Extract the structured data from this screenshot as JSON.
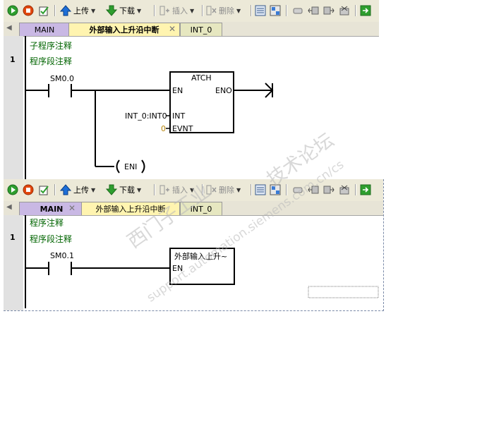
{
  "toolbar": {
    "upload_label": "上传",
    "download_label": "下载",
    "insert_label": "插入",
    "delete_label": "删除"
  },
  "colors": {
    "accent_green": "#2e9e2e",
    "stop_red": "#e2470d",
    "arrow_blue": "#1e6fd8",
    "comment_green": "#006400"
  },
  "panel1": {
    "tabs": [
      {
        "label": "MAIN"
      },
      {
        "label": "外部输入上升沿中断"
      },
      {
        "label": "INT_0"
      }
    ],
    "block_comment": "子程序注释",
    "network_number": "1",
    "network_comment": "程序段注释",
    "contact_label": "SM0.0",
    "box_title": "ATCH",
    "pin_en": "EN",
    "pin_eno": "ENO",
    "pin_int": "INT",
    "pin_evnt": "EVNT",
    "int_operand": "INT_0:INT0",
    "evnt_value": "0",
    "coil_label": "ENI"
  },
  "panel2": {
    "tabs": [
      {
        "label": "MAIN"
      },
      {
        "label": "外部输入上升沿中断"
      },
      {
        "label": "INT_0"
      }
    ],
    "block_comment": "程序注释",
    "network_number": "1",
    "network_comment": "程序段注释",
    "contact_label": "SM0.1",
    "box_title": "外部输入上升~",
    "pin_en": "EN"
  },
  "watermark": {
    "text1": "西门子工业",
    "text2": "技术论坛",
    "text3": "support.automation.siemens.com.cn/cs"
  }
}
